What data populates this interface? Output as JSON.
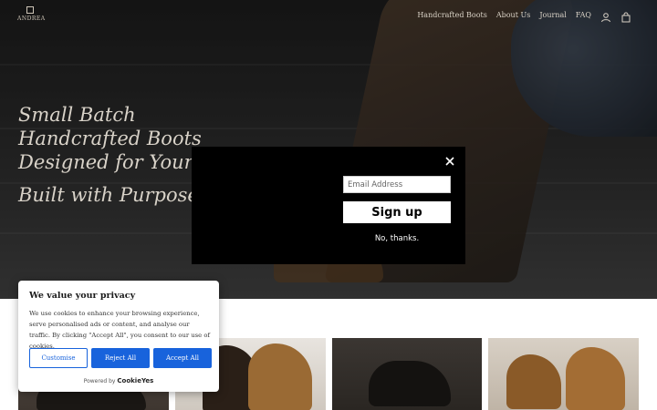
{
  "header": {
    "logo_text": "ANDREA",
    "nav": [
      {
        "label": "Handcrafted Boots"
      },
      {
        "label": "About Us"
      },
      {
        "label": "Journal"
      },
      {
        "label": "FAQ"
      }
    ],
    "icons": [
      "account-icon",
      "cart-icon"
    ]
  },
  "hero": {
    "line1": "Small Batch",
    "line2": "Handcrafted Boots",
    "line3": "Designed for Your S",
    "line4": "Built with Purpose"
  },
  "modal": {
    "email_placeholder": "Email Address",
    "signup_label": "Sign up",
    "nothanks_label": "No, thanks.",
    "close_icon": "close-icon"
  },
  "cookie": {
    "title": "We value your privacy",
    "body": "We use cookies to enhance your browsing experience, serve personalised ads or content, and analyse our traffic. By clicking \"Accept All\", you consent to our use of cookies.",
    "customise_label": "Customise",
    "reject_label": "Reject All",
    "accept_label": "Accept All",
    "powered_prefix": "Powered by",
    "powered_brand": "CookieYes",
    "accent_color": "#1863dc"
  }
}
